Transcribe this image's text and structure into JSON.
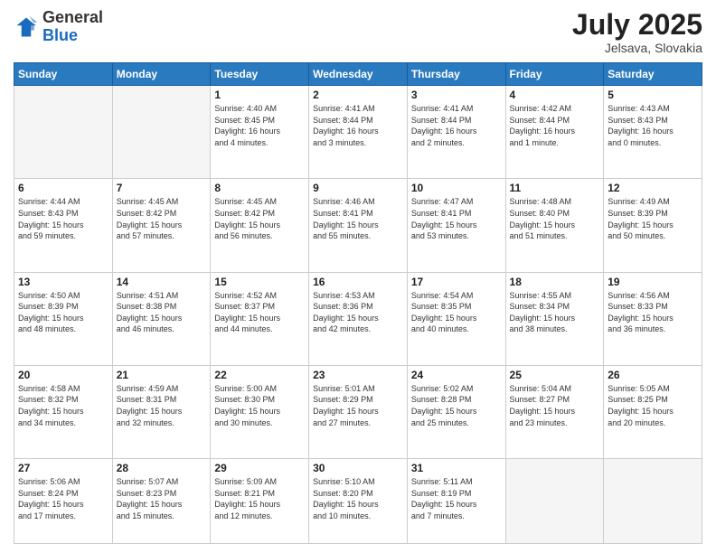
{
  "header": {
    "logo": {
      "general": "General",
      "blue": "Blue"
    },
    "title": "July 2025",
    "location": "Jelsava, Slovakia"
  },
  "weekdays": [
    "Sunday",
    "Monday",
    "Tuesday",
    "Wednesday",
    "Thursday",
    "Friday",
    "Saturday"
  ],
  "weeks": [
    [
      {
        "day": null,
        "info": null
      },
      {
        "day": null,
        "info": null
      },
      {
        "day": "1",
        "info": "Sunrise: 4:40 AM\nSunset: 8:45 PM\nDaylight: 16 hours\nand 4 minutes."
      },
      {
        "day": "2",
        "info": "Sunrise: 4:41 AM\nSunset: 8:44 PM\nDaylight: 16 hours\nand 3 minutes."
      },
      {
        "day": "3",
        "info": "Sunrise: 4:41 AM\nSunset: 8:44 PM\nDaylight: 16 hours\nand 2 minutes."
      },
      {
        "day": "4",
        "info": "Sunrise: 4:42 AM\nSunset: 8:44 PM\nDaylight: 16 hours\nand 1 minute."
      },
      {
        "day": "5",
        "info": "Sunrise: 4:43 AM\nSunset: 8:43 PM\nDaylight: 16 hours\nand 0 minutes."
      }
    ],
    [
      {
        "day": "6",
        "info": "Sunrise: 4:44 AM\nSunset: 8:43 PM\nDaylight: 15 hours\nand 59 minutes."
      },
      {
        "day": "7",
        "info": "Sunrise: 4:45 AM\nSunset: 8:42 PM\nDaylight: 15 hours\nand 57 minutes."
      },
      {
        "day": "8",
        "info": "Sunrise: 4:45 AM\nSunset: 8:42 PM\nDaylight: 15 hours\nand 56 minutes."
      },
      {
        "day": "9",
        "info": "Sunrise: 4:46 AM\nSunset: 8:41 PM\nDaylight: 15 hours\nand 55 minutes."
      },
      {
        "day": "10",
        "info": "Sunrise: 4:47 AM\nSunset: 8:41 PM\nDaylight: 15 hours\nand 53 minutes."
      },
      {
        "day": "11",
        "info": "Sunrise: 4:48 AM\nSunset: 8:40 PM\nDaylight: 15 hours\nand 51 minutes."
      },
      {
        "day": "12",
        "info": "Sunrise: 4:49 AM\nSunset: 8:39 PM\nDaylight: 15 hours\nand 50 minutes."
      }
    ],
    [
      {
        "day": "13",
        "info": "Sunrise: 4:50 AM\nSunset: 8:39 PM\nDaylight: 15 hours\nand 48 minutes."
      },
      {
        "day": "14",
        "info": "Sunrise: 4:51 AM\nSunset: 8:38 PM\nDaylight: 15 hours\nand 46 minutes."
      },
      {
        "day": "15",
        "info": "Sunrise: 4:52 AM\nSunset: 8:37 PM\nDaylight: 15 hours\nand 44 minutes."
      },
      {
        "day": "16",
        "info": "Sunrise: 4:53 AM\nSunset: 8:36 PM\nDaylight: 15 hours\nand 42 minutes."
      },
      {
        "day": "17",
        "info": "Sunrise: 4:54 AM\nSunset: 8:35 PM\nDaylight: 15 hours\nand 40 minutes."
      },
      {
        "day": "18",
        "info": "Sunrise: 4:55 AM\nSunset: 8:34 PM\nDaylight: 15 hours\nand 38 minutes."
      },
      {
        "day": "19",
        "info": "Sunrise: 4:56 AM\nSunset: 8:33 PM\nDaylight: 15 hours\nand 36 minutes."
      }
    ],
    [
      {
        "day": "20",
        "info": "Sunrise: 4:58 AM\nSunset: 8:32 PM\nDaylight: 15 hours\nand 34 minutes."
      },
      {
        "day": "21",
        "info": "Sunrise: 4:59 AM\nSunset: 8:31 PM\nDaylight: 15 hours\nand 32 minutes."
      },
      {
        "day": "22",
        "info": "Sunrise: 5:00 AM\nSunset: 8:30 PM\nDaylight: 15 hours\nand 30 minutes."
      },
      {
        "day": "23",
        "info": "Sunrise: 5:01 AM\nSunset: 8:29 PM\nDaylight: 15 hours\nand 27 minutes."
      },
      {
        "day": "24",
        "info": "Sunrise: 5:02 AM\nSunset: 8:28 PM\nDaylight: 15 hours\nand 25 minutes."
      },
      {
        "day": "25",
        "info": "Sunrise: 5:04 AM\nSunset: 8:27 PM\nDaylight: 15 hours\nand 23 minutes."
      },
      {
        "day": "26",
        "info": "Sunrise: 5:05 AM\nSunset: 8:25 PM\nDaylight: 15 hours\nand 20 minutes."
      }
    ],
    [
      {
        "day": "27",
        "info": "Sunrise: 5:06 AM\nSunset: 8:24 PM\nDaylight: 15 hours\nand 17 minutes."
      },
      {
        "day": "28",
        "info": "Sunrise: 5:07 AM\nSunset: 8:23 PM\nDaylight: 15 hours\nand 15 minutes."
      },
      {
        "day": "29",
        "info": "Sunrise: 5:09 AM\nSunset: 8:21 PM\nDaylight: 15 hours\nand 12 minutes."
      },
      {
        "day": "30",
        "info": "Sunrise: 5:10 AM\nSunset: 8:20 PM\nDaylight: 15 hours\nand 10 minutes."
      },
      {
        "day": "31",
        "info": "Sunrise: 5:11 AM\nSunset: 8:19 PM\nDaylight: 15 hours\nand 7 minutes."
      },
      {
        "day": null,
        "info": null
      },
      {
        "day": null,
        "info": null
      }
    ]
  ]
}
